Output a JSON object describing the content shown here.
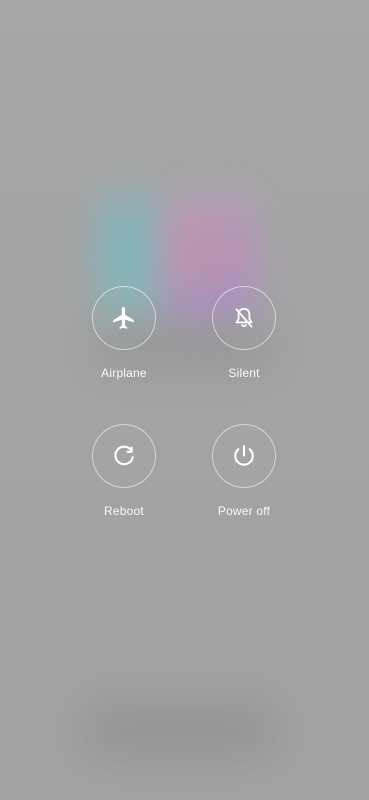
{
  "actions": [
    {
      "id": "airplane",
      "label": "Airplane",
      "icon": "airplane-icon"
    },
    {
      "id": "silent",
      "label": "Silent",
      "icon": "bell-off-icon"
    },
    {
      "id": "reboot",
      "label": "Reboot",
      "icon": "reboot-icon"
    },
    {
      "id": "power_off",
      "label": "Power off",
      "icon": "power-icon"
    }
  ],
  "colors": {
    "background": "#a3a3a3",
    "text": "#ffffff",
    "ring": "rgba(255,255,255,0.55)"
  }
}
